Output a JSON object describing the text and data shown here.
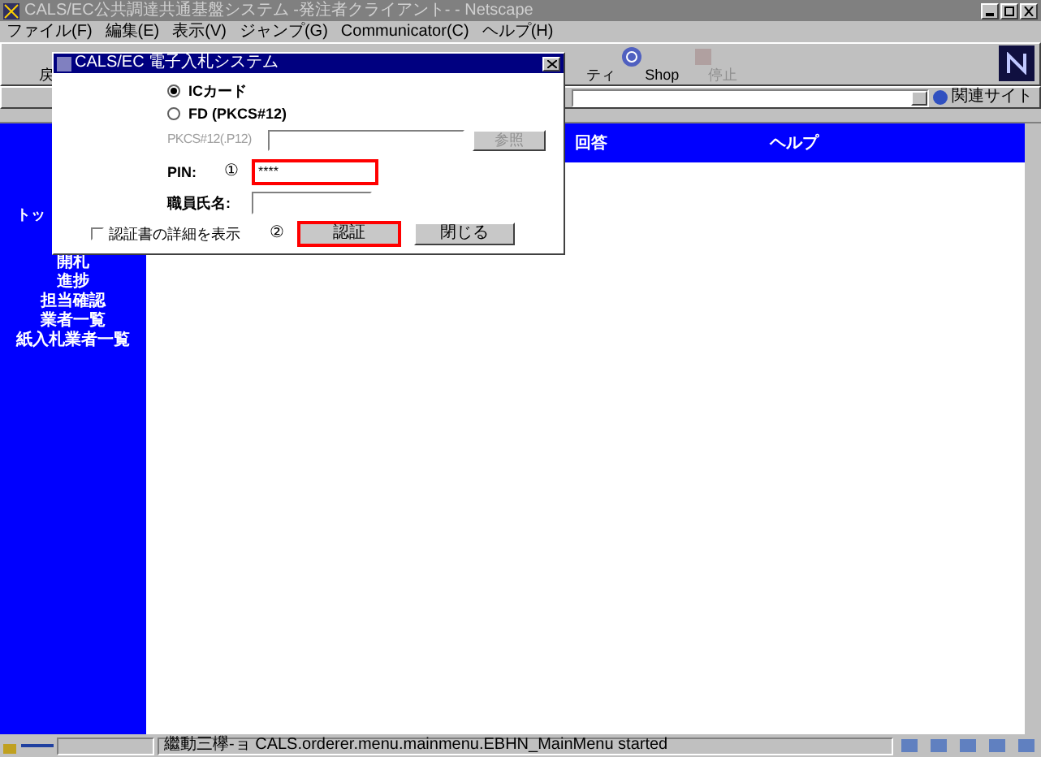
{
  "window": {
    "title": "CALS/EC公共調達共通基盤システム -発注者クライアント- - Netscape"
  },
  "menu": [
    "ファイル(F)",
    "編集(E)",
    "表示(V)",
    "ジャンプ(G)",
    "Communicator(C)",
    "ヘルプ(H)"
  ],
  "toolbar": [
    {
      "label": "戻",
      "disabled": false
    },
    {
      "label": "ティ",
      "disabled": false
    },
    {
      "label": "Shop",
      "disabled": false
    },
    {
      "label": "停止",
      "disabled": true
    }
  ],
  "location_bar": {
    "related_sites": "関連サイト"
  },
  "content": {
    "header": [
      "回答",
      "ヘルプ"
    ],
    "nav": [
      "トッ",
      "開札",
      "進捗",
      "担当確認",
      "業者一覧",
      "紙入札業者一覧"
    ]
  },
  "dialog": {
    "title": "CALS/EC 電子入札システム",
    "options": [
      {
        "label": "ICカード",
        "selected": true
      },
      {
        "label": "FD (PKCS#12)",
        "selected": false
      }
    ],
    "file_label": "PKCS#12(.P12)",
    "browse_button": "参照",
    "file_disabled": true,
    "pin_label": "PIN:",
    "pin_marker": "①",
    "pin_value": "****",
    "name_label": "職員氏名:",
    "details_checkbox": {
      "label": "認証書の詳細を表示",
      "checked": false
    },
    "auth_marker": "②",
    "auth_button": "認証",
    "close_button": "閉じる"
  },
  "status_bar": {
    "text": "繼動三欅-ョ CALS.orderer.menu.mainmenu.EBHN_MainMenu started"
  }
}
